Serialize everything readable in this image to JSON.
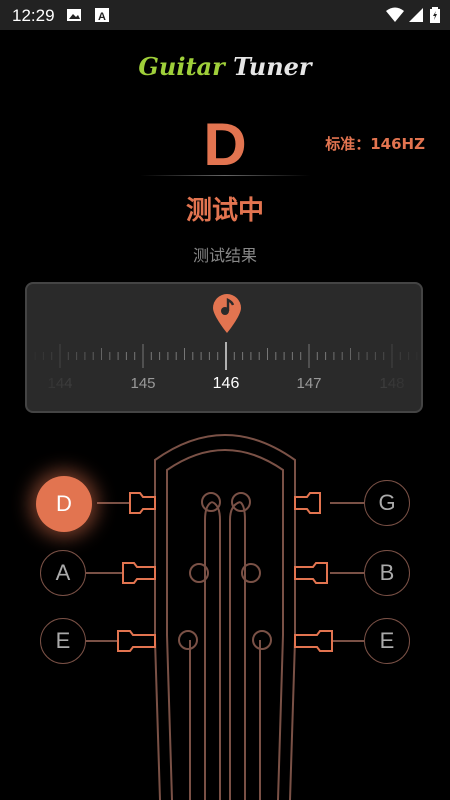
{
  "status_bar": {
    "time": "12:29",
    "icons": [
      "image-icon",
      "text-icon",
      "wifi-icon",
      "signal-icon",
      "battery-icon"
    ]
  },
  "app": {
    "title_part1": "Guitar",
    "title_part2": "Tuner",
    "current_note": "D",
    "standard_label": "标准：146HZ",
    "status": "测试中",
    "result_label": "测试结果"
  },
  "dial": {
    "ticks_labels": [
      "144",
      "145",
      "146",
      "147",
      "148"
    ],
    "current_value": 146
  },
  "strings": {
    "left": [
      {
        "note": "D",
        "active": true
      },
      {
        "note": "A",
        "active": false
      },
      {
        "note": "E",
        "active": false
      }
    ],
    "right": [
      {
        "note": "G",
        "active": false
      },
      {
        "note": "B",
        "active": false
      },
      {
        "note": "E",
        "active": false
      }
    ]
  },
  "colors": {
    "accent": "#e27450",
    "title_green": "#9fcf3a",
    "headstock_line": "#7a5146",
    "background": "#000000"
  }
}
